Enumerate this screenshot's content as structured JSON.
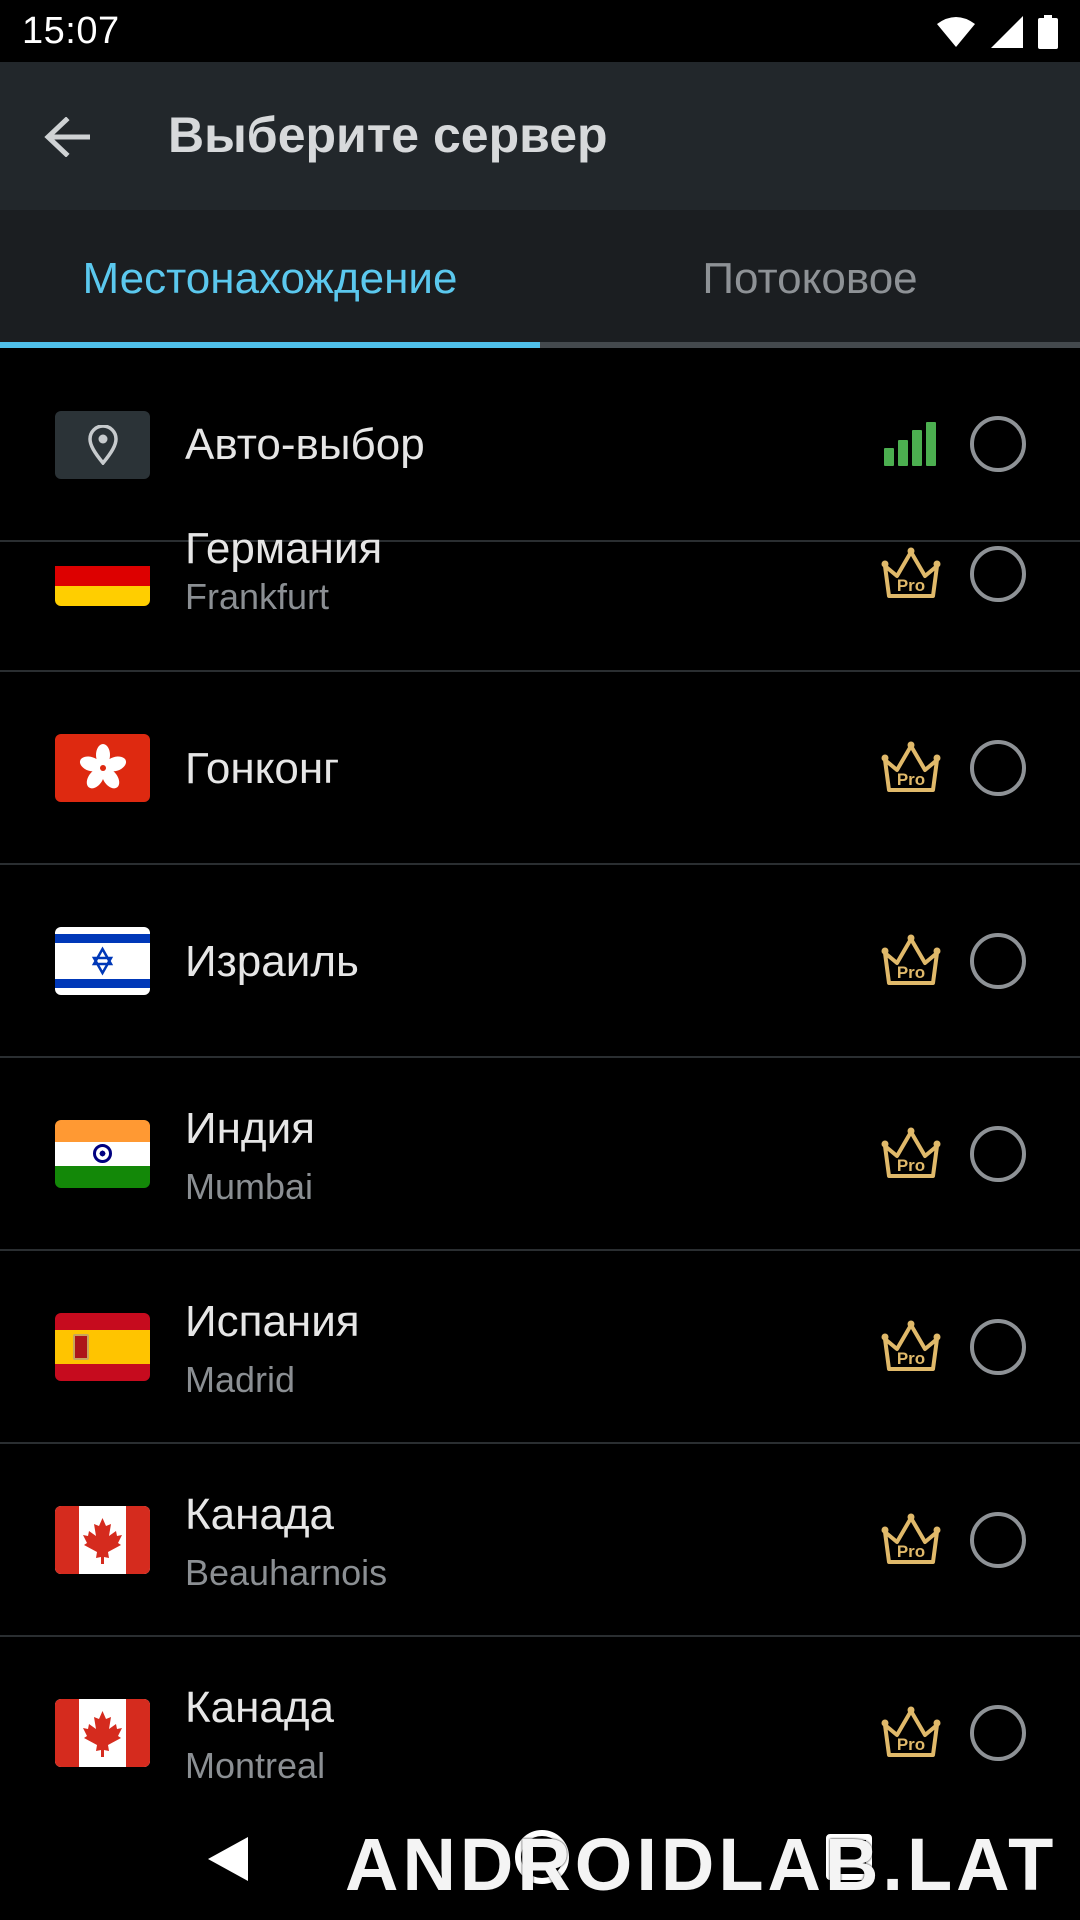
{
  "status_bar": {
    "time": "15:07"
  },
  "app_bar": {
    "title": "Выберите сервер"
  },
  "tabs": [
    {
      "label": "Местонахождение",
      "selected": true
    },
    {
      "label": "Потоковое",
      "selected": false
    }
  ],
  "colors": {
    "accent": "#4fc0ea",
    "pro_badge": "#e0b96a",
    "signal": "#4caf50",
    "background": "#000000"
  },
  "auto_select": {
    "label": "Авто-выбор",
    "icon": "location-pin-icon",
    "signal": "signal-bars-icon"
  },
  "servers": [
    {
      "country": "Германия",
      "city": "Frankfurt",
      "flag": "germany",
      "badge": "Pro"
    },
    {
      "country": "Гонконг",
      "city": "",
      "flag": "hong-kong",
      "badge": "Pro"
    },
    {
      "country": "Израиль",
      "city": "",
      "flag": "israel",
      "badge": "Pro"
    },
    {
      "country": "Индия",
      "city": "Mumbai",
      "flag": "india",
      "badge": "Pro"
    },
    {
      "country": "Испания",
      "city": "Madrid",
      "flag": "spain",
      "badge": "Pro"
    },
    {
      "country": "Канада",
      "city": "Beauharnois",
      "flag": "canada",
      "badge": "Pro"
    },
    {
      "country": "Канада",
      "city": "Montreal",
      "flag": "canada",
      "badge": "Pro"
    }
  ],
  "watermark": "ANDROIDLAB.LAT"
}
